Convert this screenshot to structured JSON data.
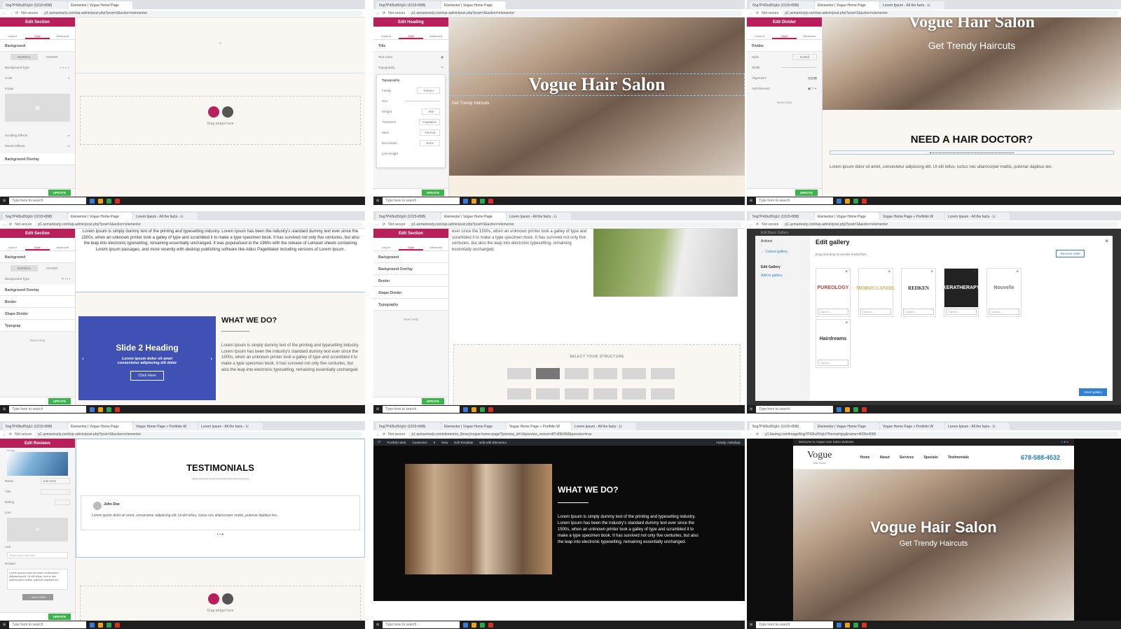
{
  "common": {
    "tab_elementor": "Elementor | Vogue Home Page",
    "tab_img": "5ng7P42kz8VgUr (1015×898)",
    "tab_lorem": "Lorem Ipsum - All the facts - Li",
    "tab_portfolio": "Vogue Home Page » Portfolio W",
    "not_secure": "Not secure",
    "url": "p1.azmanirarly.com/wp-admin/post.php?post=3&action=elementor",
    "taskbar_search": "Type here to search",
    "update": "UPDATE",
    "need_help": "Need Help"
  },
  "p1": {
    "panel_title": "Edit Section",
    "tabs": [
      "Layout",
      "Style",
      "Advanced"
    ],
    "section_background": "Background",
    "normal": "NORMAL",
    "hover": "HOVER",
    "background_type": "Background Type",
    "color": "Color",
    "image": "Image",
    "scrolling": "Scrolling Effects",
    "mouse": "Mouse Effects",
    "overlay": "Background Overlay",
    "drag_widget": "Drag widget here"
  },
  "p2": {
    "panel_title": "Edit Heading",
    "tabs": [
      "Content",
      "Style",
      "Advanced"
    ],
    "section_title": "Title",
    "text_color": "Text Color",
    "typography": "Typography",
    "typography_popup": "Typography",
    "family": "Family",
    "family_val": "Roboto",
    "size": "Size",
    "weight": "Weight",
    "weight_val": "600",
    "transform": "Transform",
    "transform_val": "Capitalize",
    "style": "Style",
    "style_val": "Normal",
    "decoration": "Decoration",
    "decoration_val": "None",
    "line_height": "Line-Height",
    "hero_title": "Vogue Hair Salon",
    "hero_sub": "Get Trendy Haircuts"
  },
  "p3": {
    "panel_title": "Edit Divider",
    "tabs": [
      "Content",
      "Style",
      "Advanced"
    ],
    "divider": "Divider",
    "style": "Style",
    "style_val": "Dotted",
    "width": "Width",
    "alignment": "Alignment",
    "add_element": "Add Element",
    "hero_title": "Vogue Hair Salon",
    "hero_sub": "Get Trendy Haircuts",
    "heading": "NEED A HAIR DOCTOR?",
    "text": "Lorem ipsum dolor sit amet, consectetur adipiscing elit. Ut elit tellus, luctus nec ullamcorper mattis, pulvinar dapibus leo."
  },
  "p4": {
    "panel_title": "Edit Section",
    "tabs": [
      "Layout",
      "Style",
      "Advanced"
    ],
    "background": "Background",
    "normal": "NORMAL",
    "hover": "HOVER",
    "background_type": "Background Type",
    "overlay": "Background Overlay",
    "border": "Border",
    "shape": "Shape Divider",
    "typography": "Typograp",
    "top_text": "Lorem Ipsum is simply dummy text of the printing and typesetting industry. Lorem Ipsum has been the industry's standard dummy text ever since the 1500s, when an unknown printer took a galley of type and scrambled it to make a type specimen book. It has survived not only five centuries, but also the leap into electronic typesetting, remaining essentially unchanged. It was popularised in the 1960s with the release of Letraset sheets containing Lorem Ipsum passages, and more recently with desktop publishing software like Aldus PageMaker including versions of Lorem Ipsum.",
    "slide_heading": "Slide 2 Heading",
    "slide_text": "Lorem ipsum dolor sit amet consectetur adipiscing elit dolor",
    "slide_button": "Click Here",
    "what_heading": "WHAT WE DO?",
    "what_text": "Lorem Ipsum is simply dummy text of the printing and typesetting industry. Lorem Ipsum has been the industry's standard dummy text ever since the 1500s, when an unknown printer took a galley of type and scrambled it to make a type specimen book. It has survived not only five centuries, but also the leap into electronic typesetting, remaining essentially unchanged.",
    "status_url": "p1.azmanirarly.com/wp-admin/post.php?post=3&action=elementor"
  },
  "p5": {
    "panel_title": "Edit Section",
    "tabs": [
      "Layout",
      "Style",
      "Advanced"
    ],
    "sections": [
      "Background",
      "Background Overlay",
      "Border",
      "Shape Divider",
      "Typography"
    ],
    "text": "ever since the 1500s, when an unknown printer took a galley of type and scrambled it to make a type specimen book. It has survived not only five centuries, but also the leap into electronic typesetting, remaining essentially unchanged.",
    "select_structure": "SELECT YOUR STRUCTURE"
  },
  "p6": {
    "actions": "Actions",
    "cancel": "← Cancel gallery",
    "edit_gallery_link": "Edit Gallery",
    "add_to_gallery": "Add to gallery",
    "title": "Edit gallery",
    "hint": "Drag and drop to reorder media files.",
    "reverse": "Reverse order",
    "caption": "Caption...",
    "logos": [
      "PUREOLOGY",
      "MOROCCANOIL",
      "REDKEN",
      "KERATHERAPY",
      "Nouvelle",
      "Hairdreams"
    ],
    "insert": "Insert gallery",
    "bg_title": "Edit Basic Gallery"
  },
  "p7": {
    "panel_title": "Edit Reviews",
    "image": "Image",
    "name": "Name",
    "name_val": "John Doe",
    "title": "Title",
    "rating": "Rating",
    "icon": "Icon",
    "link": "Link",
    "link_placeholder": "https://your-link.com",
    "review": "Review",
    "review_val": "Lorem ipsum dolor sit amet consectetur adipiscing elit. Ut elit tellus, luctus nec ullamcorper mattis, pulvinar dapibus leo.",
    "add_item": "+ ADD ITEM",
    "heading": "TESTIMONIALS",
    "card_name": "John Doe",
    "card_text": "Lorem ipsum dolor sit amet, consectetur adipiscing elit. Ut elit tellus, luctus nec ullamcorper mattis, pulvinar dapibus leo.",
    "drag_widget": "Drag widget here"
  },
  "p8": {
    "url": "p1.azmanirarly.com/elementor_library/vogue-home-page/?preview_id=1&preview_nonce=df7c83b3b0&preview=true",
    "admin_items": [
      "Portfolio Web",
      "Customize",
      "0",
      "New",
      "Edit Template",
      "Edit with Elementor"
    ],
    "howdy": "Howdy, mdrafyq1",
    "heading": "WHAT WE DO?",
    "text": "Lorem Ipsum is simply dummy text of the printing and typesetting industry. Lorem Ipsum has been the industry's standard dummy text ever since the 1500s, when an unknown printer took a galley of type and scrambled it to make a type specimen book. It has survived not only five centuries, but also the leap into electronic typesetting, remaining essentially unchanged."
  },
  "p9": {
    "url": "p1.ibeimg.com/image/5ng7P42kz8VgUr?format=jpg&name=4096x4096",
    "welcome": "Welcome to Vogue Hair Salon Website!",
    "logo": "Vogue",
    "logo_sub": "Hair Salon",
    "nav": [
      "Home",
      "About",
      "Services",
      "Specials",
      "Testimonials"
    ],
    "phone": "678-588-4532",
    "hero_title": "Vogue Hair Salon",
    "hero_sub": "Get Trendy Haircuts"
  },
  "colors": {
    "elementor": "#b81f5b",
    "update": "#39b54a",
    "slide_bg": "#3f51b5",
    "accent_blue": "#2f80d1",
    "phone": "#1f7fc1"
  }
}
